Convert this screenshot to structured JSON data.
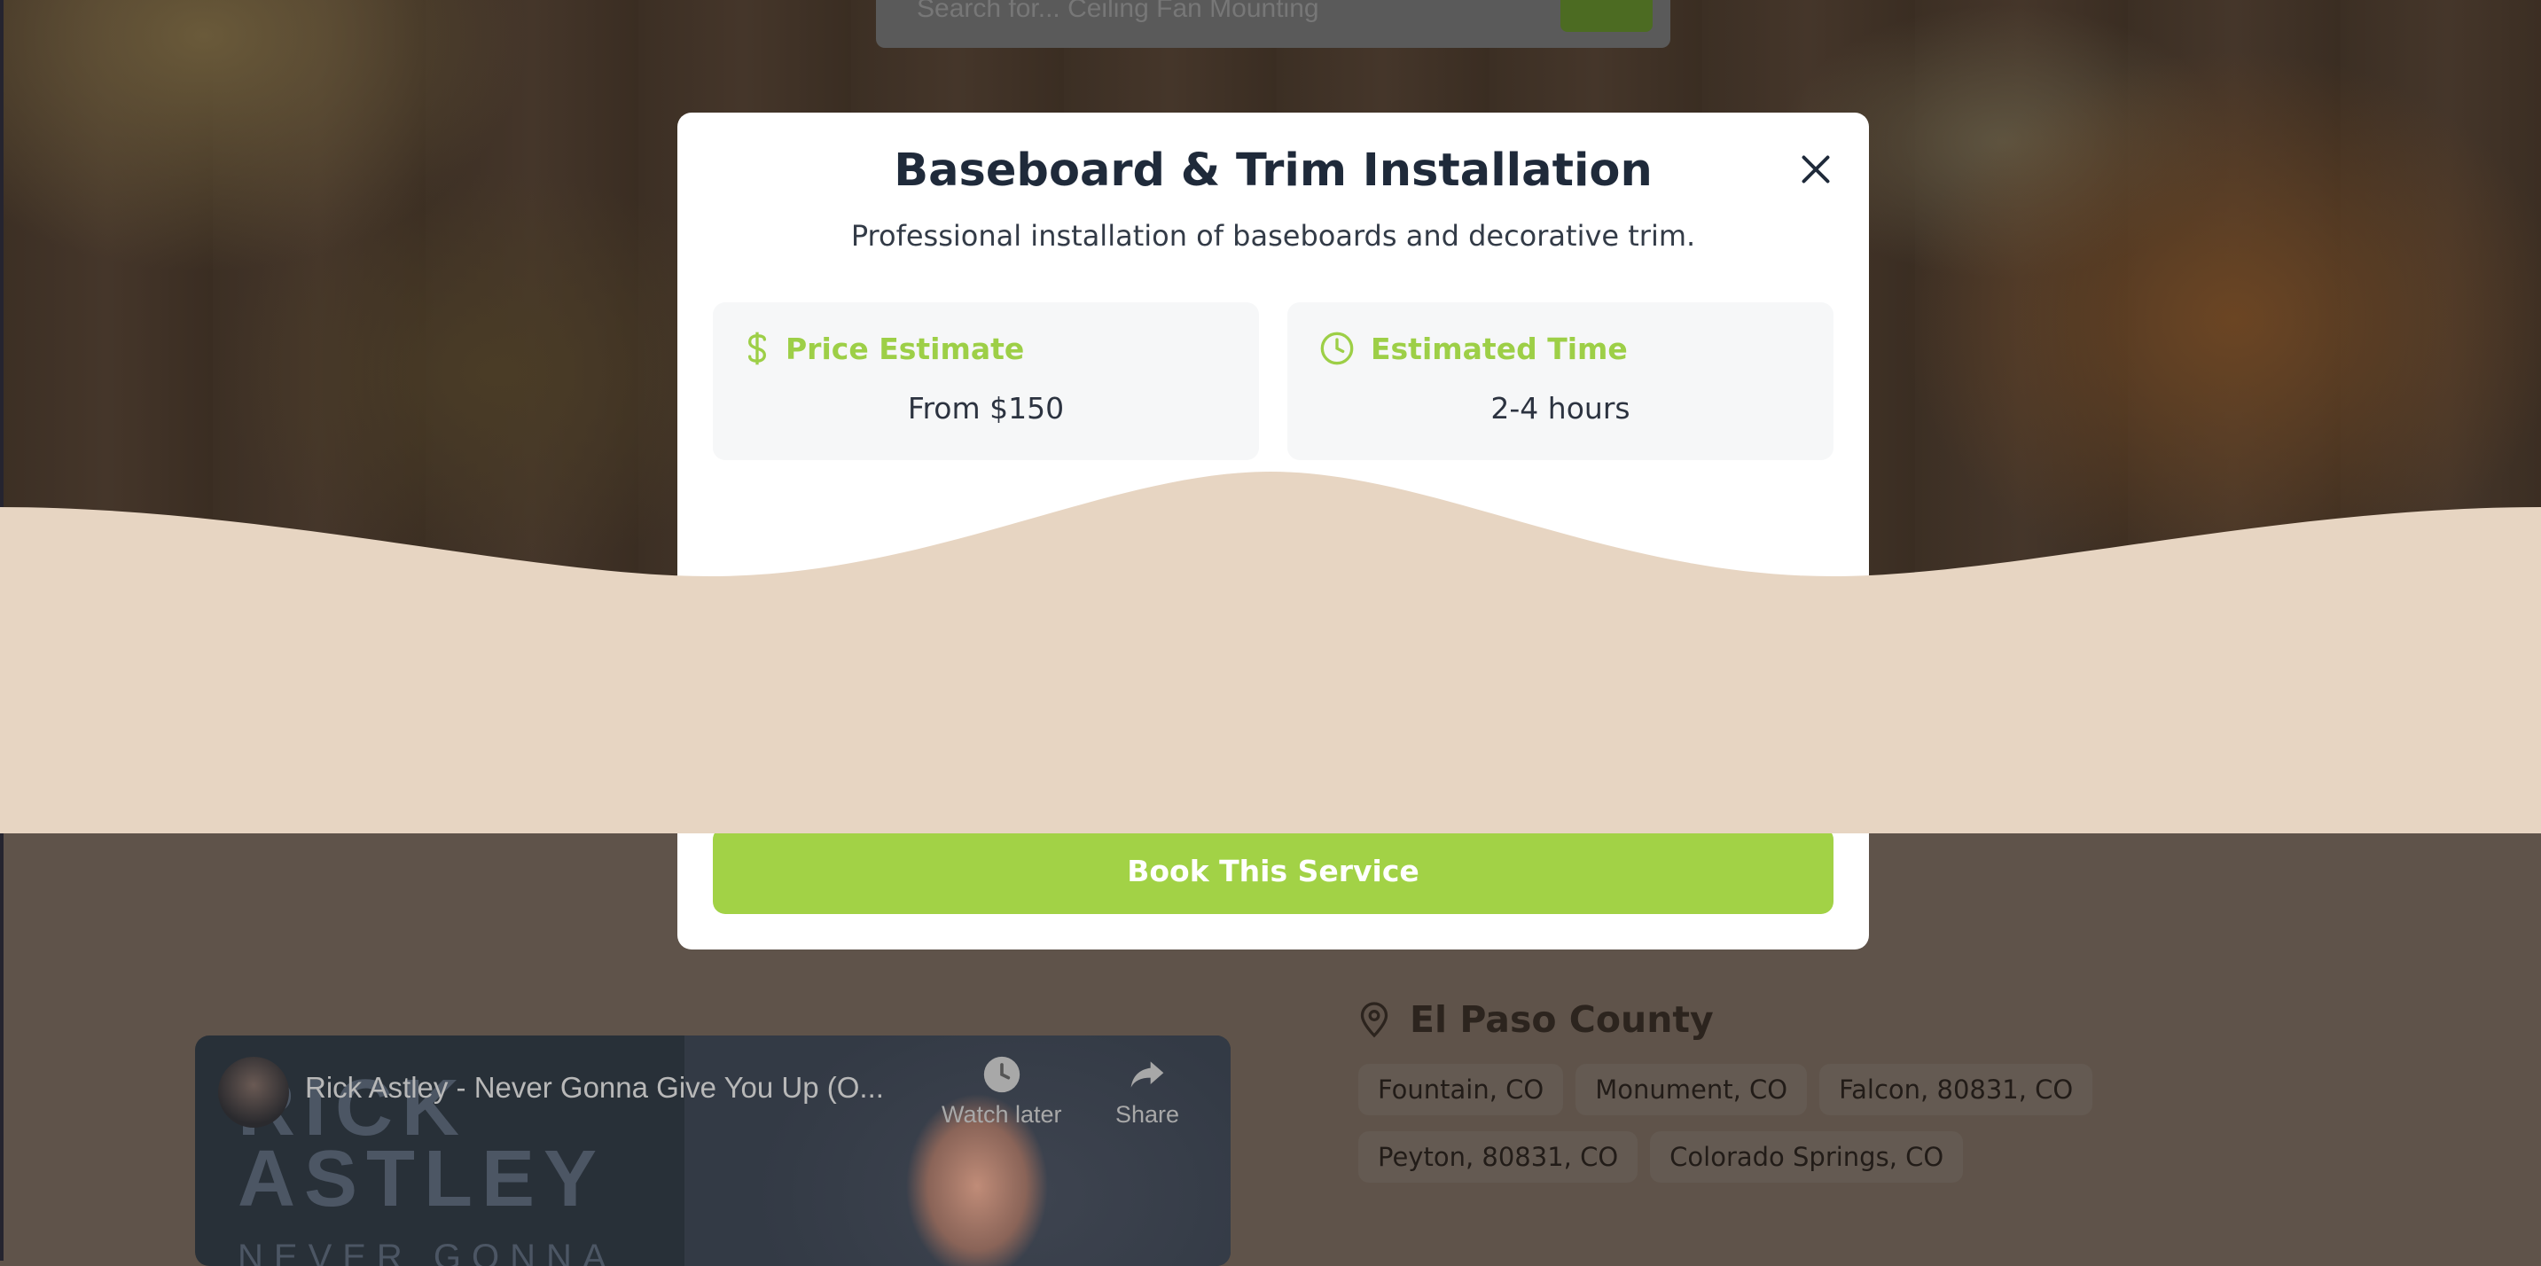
{
  "background": {
    "search_placeholder": "Search for... Ceiling Fan Mounting"
  },
  "modal": {
    "title": "Baseboard & Trim Installation",
    "description": "Professional installation of baseboards and decorative trim.",
    "price": {
      "label": "Price Estimate",
      "value": "From $150",
      "icon": "dollar-icon"
    },
    "time": {
      "label": "Estimated Time",
      "value": "2-4 hours",
      "icon": "clock-icon"
    },
    "book_label": "Book This Service",
    "close_icon": "close-icon"
  },
  "video": {
    "title": "Rick Astley - Never Gonna Give You Up (O...",
    "thumb_line1": "RICK",
    "thumb_line2": "ASTLEY",
    "thumb_line3": "NEVER GONNA",
    "watch_later": "Watch later",
    "share": "Share"
  },
  "county": {
    "title": "El Paso County",
    "areas": [
      "Fountain, CO",
      "Monument, CO",
      "Falcon, 80831, CO",
      "Peyton, 80831, CO",
      "Colorado Springs, CO"
    ]
  },
  "colors": {
    "accent": "#a2d246",
    "wave": "#e7d5c2",
    "heading": "#1f2a3a"
  }
}
